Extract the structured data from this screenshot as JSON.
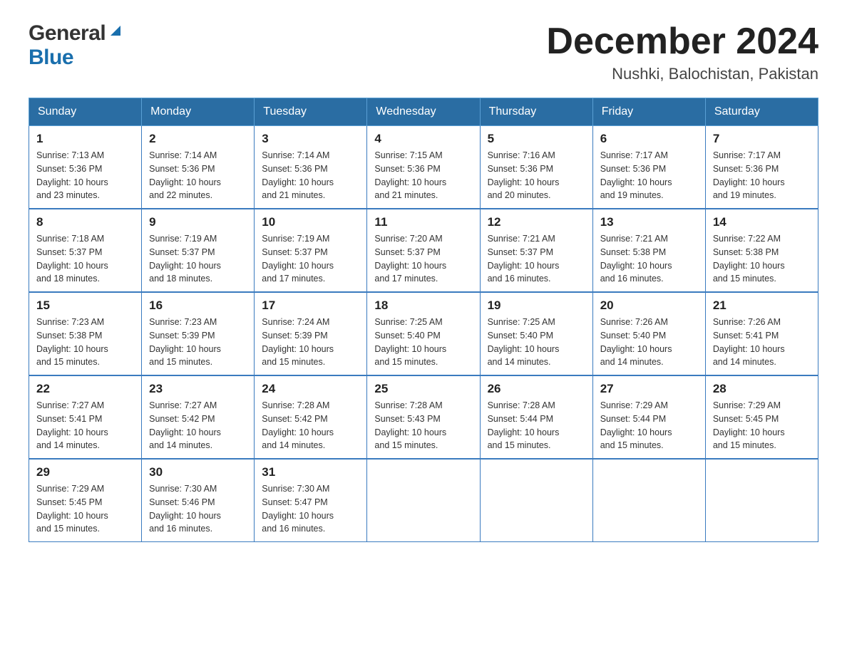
{
  "logo": {
    "general": "General",
    "blue": "Blue"
  },
  "header": {
    "title": "December 2024",
    "subtitle": "Nushki, Balochistan, Pakistan"
  },
  "weekdays": [
    "Sunday",
    "Monday",
    "Tuesday",
    "Wednesday",
    "Thursday",
    "Friday",
    "Saturday"
  ],
  "weeks": [
    [
      {
        "day": "1",
        "sunrise": "7:13 AM",
        "sunset": "5:36 PM",
        "daylight": "10 hours and 23 minutes."
      },
      {
        "day": "2",
        "sunrise": "7:14 AM",
        "sunset": "5:36 PM",
        "daylight": "10 hours and 22 minutes."
      },
      {
        "day": "3",
        "sunrise": "7:14 AM",
        "sunset": "5:36 PM",
        "daylight": "10 hours and 21 minutes."
      },
      {
        "day": "4",
        "sunrise": "7:15 AM",
        "sunset": "5:36 PM",
        "daylight": "10 hours and 21 minutes."
      },
      {
        "day": "5",
        "sunrise": "7:16 AM",
        "sunset": "5:36 PM",
        "daylight": "10 hours and 20 minutes."
      },
      {
        "day": "6",
        "sunrise": "7:17 AM",
        "sunset": "5:36 PM",
        "daylight": "10 hours and 19 minutes."
      },
      {
        "day": "7",
        "sunrise": "7:17 AM",
        "sunset": "5:36 PM",
        "daylight": "10 hours and 19 minutes."
      }
    ],
    [
      {
        "day": "8",
        "sunrise": "7:18 AM",
        "sunset": "5:37 PM",
        "daylight": "10 hours and 18 minutes."
      },
      {
        "day": "9",
        "sunrise": "7:19 AM",
        "sunset": "5:37 PM",
        "daylight": "10 hours and 18 minutes."
      },
      {
        "day": "10",
        "sunrise": "7:19 AM",
        "sunset": "5:37 PM",
        "daylight": "10 hours and 17 minutes."
      },
      {
        "day": "11",
        "sunrise": "7:20 AM",
        "sunset": "5:37 PM",
        "daylight": "10 hours and 17 minutes."
      },
      {
        "day": "12",
        "sunrise": "7:21 AM",
        "sunset": "5:37 PM",
        "daylight": "10 hours and 16 minutes."
      },
      {
        "day": "13",
        "sunrise": "7:21 AM",
        "sunset": "5:38 PM",
        "daylight": "10 hours and 16 minutes."
      },
      {
        "day": "14",
        "sunrise": "7:22 AM",
        "sunset": "5:38 PM",
        "daylight": "10 hours and 15 minutes."
      }
    ],
    [
      {
        "day": "15",
        "sunrise": "7:23 AM",
        "sunset": "5:38 PM",
        "daylight": "10 hours and 15 minutes."
      },
      {
        "day": "16",
        "sunrise": "7:23 AM",
        "sunset": "5:39 PM",
        "daylight": "10 hours and 15 minutes."
      },
      {
        "day": "17",
        "sunrise": "7:24 AM",
        "sunset": "5:39 PM",
        "daylight": "10 hours and 15 minutes."
      },
      {
        "day": "18",
        "sunrise": "7:25 AM",
        "sunset": "5:40 PM",
        "daylight": "10 hours and 15 minutes."
      },
      {
        "day": "19",
        "sunrise": "7:25 AM",
        "sunset": "5:40 PM",
        "daylight": "10 hours and 14 minutes."
      },
      {
        "day": "20",
        "sunrise": "7:26 AM",
        "sunset": "5:40 PM",
        "daylight": "10 hours and 14 minutes."
      },
      {
        "day": "21",
        "sunrise": "7:26 AM",
        "sunset": "5:41 PM",
        "daylight": "10 hours and 14 minutes."
      }
    ],
    [
      {
        "day": "22",
        "sunrise": "7:27 AM",
        "sunset": "5:41 PM",
        "daylight": "10 hours and 14 minutes."
      },
      {
        "day": "23",
        "sunrise": "7:27 AM",
        "sunset": "5:42 PM",
        "daylight": "10 hours and 14 minutes."
      },
      {
        "day": "24",
        "sunrise": "7:28 AM",
        "sunset": "5:42 PM",
        "daylight": "10 hours and 14 minutes."
      },
      {
        "day": "25",
        "sunrise": "7:28 AM",
        "sunset": "5:43 PM",
        "daylight": "10 hours and 15 minutes."
      },
      {
        "day": "26",
        "sunrise": "7:28 AM",
        "sunset": "5:44 PM",
        "daylight": "10 hours and 15 minutes."
      },
      {
        "day": "27",
        "sunrise": "7:29 AM",
        "sunset": "5:44 PM",
        "daylight": "10 hours and 15 minutes."
      },
      {
        "day": "28",
        "sunrise": "7:29 AM",
        "sunset": "5:45 PM",
        "daylight": "10 hours and 15 minutes."
      }
    ],
    [
      {
        "day": "29",
        "sunrise": "7:29 AM",
        "sunset": "5:45 PM",
        "daylight": "10 hours and 15 minutes."
      },
      {
        "day": "30",
        "sunrise": "7:30 AM",
        "sunset": "5:46 PM",
        "daylight": "10 hours and 16 minutes."
      },
      {
        "day": "31",
        "sunrise": "7:30 AM",
        "sunset": "5:47 PM",
        "daylight": "10 hours and 16 minutes."
      },
      null,
      null,
      null,
      null
    ]
  ],
  "labels": {
    "sunrise": "Sunrise:",
    "sunset": "Sunset:",
    "daylight": "Daylight:"
  }
}
